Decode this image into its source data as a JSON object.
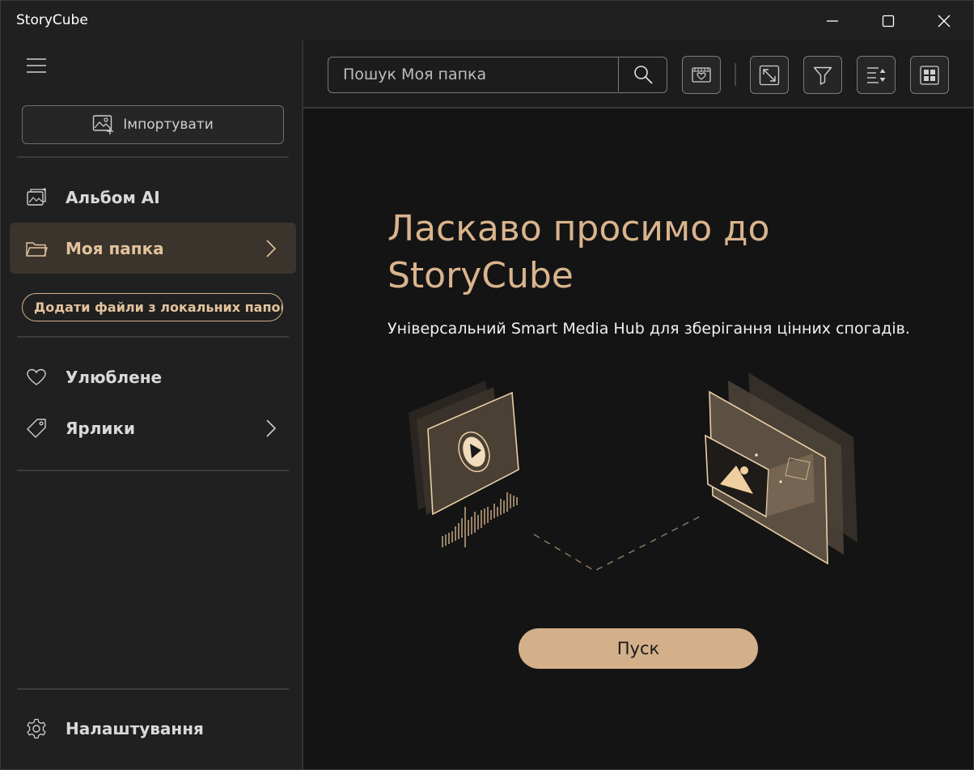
{
  "app": {
    "title": "StoryCube"
  },
  "window_controls": {
    "minimize": "minimize-icon",
    "maximize": "maximize-icon",
    "close": "close-icon"
  },
  "sidebar": {
    "import_label": "Імпортувати",
    "items": [
      {
        "label": "Альбом AI",
        "icon": "ai-album-icon"
      },
      {
        "label": "Моя папка",
        "icon": "folder-icon",
        "active": true
      },
      {
        "label": "Улюблене",
        "icon": "heart-icon"
      },
      {
        "label": "Ярлики",
        "icon": "tag-icon"
      }
    ],
    "add_local_label": "Додати файли з локальних папок",
    "settings_label": "Налаштування"
  },
  "toolbar": {
    "search_placeholder": "Пошук Моя папка"
  },
  "welcome": {
    "title": "Ласкаво просимо до StoryCube",
    "subtitle": "Універсальний Smart Media Hub для зберігання цінних спогадів.",
    "start_label": "Пуск"
  },
  "colors": {
    "accent": "#d4b08a",
    "accent_text": "#e3c39d",
    "background": "#141414",
    "sidebar": "#202020",
    "active_item": "#3b342c"
  }
}
